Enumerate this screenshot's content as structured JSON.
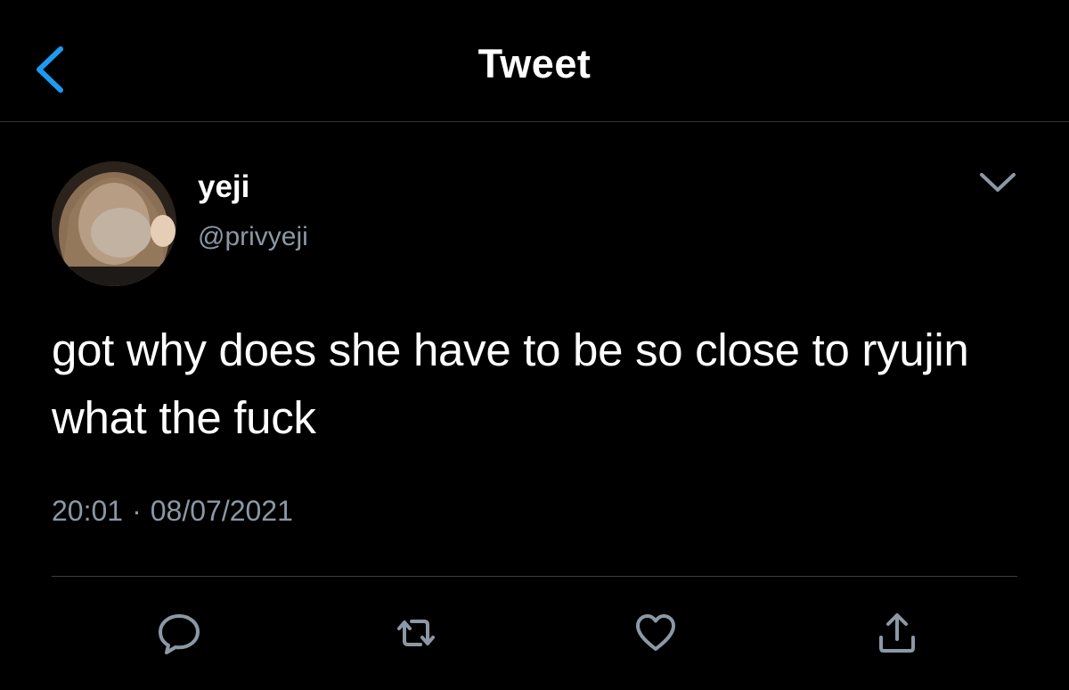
{
  "header": {
    "title": "Tweet",
    "back_icon": "chevron-left-icon"
  },
  "tweet": {
    "author_name": "yeji",
    "author_handle": "@privyeji",
    "text": "got why does she have to be so close to ryujin what the fuck",
    "time": "20:01",
    "separator": "·",
    "date": "08/07/2021"
  },
  "actions": [
    {
      "icon": "reply-icon"
    },
    {
      "icon": "retweet-icon"
    },
    {
      "icon": "like-icon"
    },
    {
      "icon": "share-icon"
    }
  ],
  "colors": {
    "background": "#000000",
    "accent": "#1d9bf0",
    "secondary_text": "#8b98a5",
    "divider": "#2f3336"
  }
}
